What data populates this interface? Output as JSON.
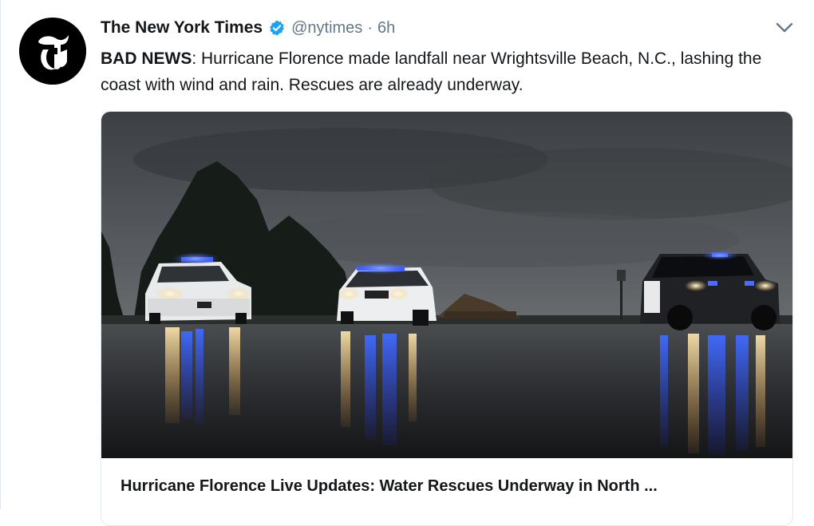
{
  "tweet": {
    "author_name": "The New York Times",
    "handle": "@nytimes",
    "separator": "·",
    "time": "6h",
    "text_lead": "BAD NEWS",
    "text_body": ": Hurricane Florence made landfall near Wrightsville Beach, N.C., lashing the coast with wind and rain. Rescues are already underway.",
    "icons": {
      "avatar": "nyt-logo-icon",
      "verified": "verified-badge-icon",
      "menu": "chevron-down-icon"
    },
    "colors": {
      "verified": "#1da1f2",
      "secondary_text": "#657786",
      "primary_text": "#14171a"
    }
  },
  "card": {
    "title": "Hurricane Florence Live Updates: Water Rescues Underway in North ..."
  }
}
